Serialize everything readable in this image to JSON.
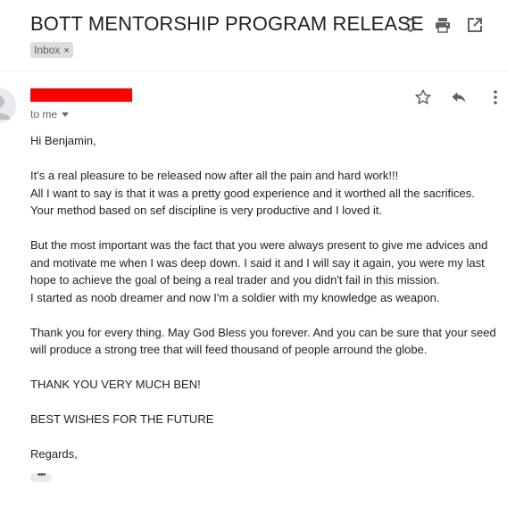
{
  "email": {
    "subject": "BOTT MENTORSHIP PROGRAM RELEASE",
    "label": "Inbox",
    "label_remove": "×",
    "to_me": "to me",
    "more_dots": "•••",
    "body": [
      "Hi Benjamin,",
      "",
      "It's a real pleasure to be released now after all the pain and hard work!!!",
      "All I want to say is that it was a pretty good experience and it worthed all the sacrifices.",
      "Your method based on sef discipline is very productive and I loved it.",
      "",
      "But the most important was the fact that you were always present to give me advices and",
      "and motivate me when I was deep down. I said it and I will say it again, you were my last",
      "hope to achieve the goal of being a real trader and you didn't fail in this mission.",
      "I started as noob dreamer and now I'm a soldier with my knowledge as weapon.",
      "",
      "Thank you for every thing. May God Bless you forever. And you can be sure that your seed",
      "will produce a strong tree that will feed thousand of people arround the globe.",
      "",
      "THANK YOU VERY MUCH BEN!",
      "",
      "BEST WISHES FOR THE FUTURE",
      "",
      "Regards,"
    ]
  },
  "icons": {
    "expand": "unfold-icon",
    "print": "print-icon",
    "open_new_window": "open-in-new-window-icon",
    "star": "star-icon",
    "reply": "reply-icon",
    "more": "more-vert-icon",
    "avatar": "person-avatar-icon"
  },
  "colors": {
    "sender_redaction": "#ff0000",
    "label_chip_bg": "#dddddd"
  }
}
